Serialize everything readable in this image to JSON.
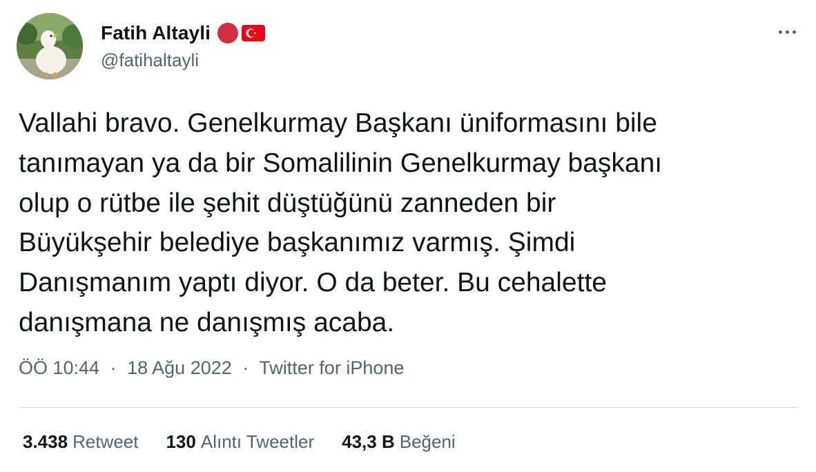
{
  "author": {
    "display_name": "Fatih Altayli",
    "handle": "@fatihaltayli",
    "avatar_icon": "duck-avatar",
    "badge_color": "#d32f3f",
    "flag_icon": "turkey-flag-icon"
  },
  "more_icon": "more-horizontal-icon",
  "tweet": {
    "lines": [
      "Vallahi bravo. Genelkurmay Başkanı üniformasını bile",
      "tanımayan ya da bir Somalilinin Genelkurmay başkanı",
      "olup o rütbe ile şehit düştüğünü zanneden bir",
      "Büyükşehir belediye başkanımız varmış. Şimdi",
      "Danışmanım yaptı diyor. O da beter. Bu cehalette",
      "danışmana ne danışmış acaba."
    ]
  },
  "meta": {
    "time": "ÖÖ 10:44",
    "separator": "·",
    "date": "18 Ağu 2022",
    "source": "Twitter for iPhone"
  },
  "stats": {
    "retweets": {
      "count": "3.438",
      "label": "Retweet"
    },
    "quotes": {
      "count": "130",
      "label": "Alıntı Tweetler"
    },
    "likes": {
      "count": "43,3 B",
      "label": "Beğeni"
    }
  },
  "colors": {
    "text": "#0f1419",
    "secondary": "#536471",
    "divider": "#cfd9de",
    "flag_red": "#e30a17"
  }
}
